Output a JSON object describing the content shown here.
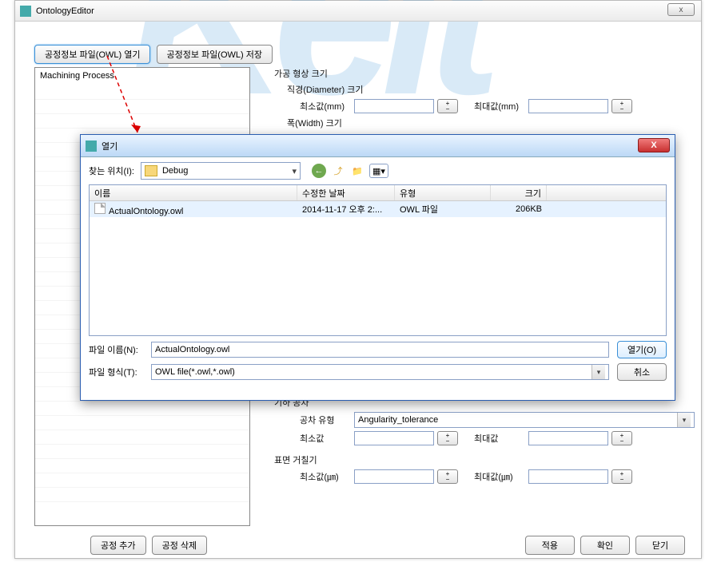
{
  "main": {
    "title": "OntologyEditor",
    "close_glyph": "x",
    "toolbar": {
      "open_btn": "공정정보 파일(OWL) 열기",
      "save_btn": "공정정보 파일(OWL) 저장"
    },
    "tree": {
      "root": "Machining Process"
    },
    "props": {
      "group_shape": "가공 형상 크기",
      "diameter": "직경(Diameter) 크기",
      "width": "폭(Width) 크기",
      "min_mm": "최소값(mm)",
      "max_mm": "최대값(mm)",
      "group_geo": "기하 공차",
      "tol_type": "공차 유형",
      "tol_type_val": "Angularity_tolerance",
      "min": "최소값",
      "max": "최대값",
      "group_rough": "표면 거칠기",
      "min_um": "최소값(㎛)",
      "max_um": "최대값(㎛)"
    },
    "bottom_left": {
      "add": "공정 추가",
      "del": "공정 삭제"
    },
    "bottom_right": {
      "apply": "적용",
      "ok": "확인",
      "close": "닫기"
    }
  },
  "dialog": {
    "title": "열기",
    "look_in": "찾는 위치(I):",
    "folder": "Debug",
    "columns": {
      "name": "이름",
      "date": "수정한 날짜",
      "type": "유형",
      "size": "크기"
    },
    "rows": [
      {
        "name": "ActualOntology.owl",
        "date": "2014-11-17 오후 2:...",
        "type": "OWL 파일",
        "size": "206KB"
      }
    ],
    "filename_label": "파일 이름(N):",
    "filename_value": "ActualOntology.owl",
    "filetype_label": "파일 형식(T):",
    "filetype_value": "OWL file(*.owl,*.owl)",
    "open_btn": "열기(O)",
    "cancel_btn": "취소"
  }
}
